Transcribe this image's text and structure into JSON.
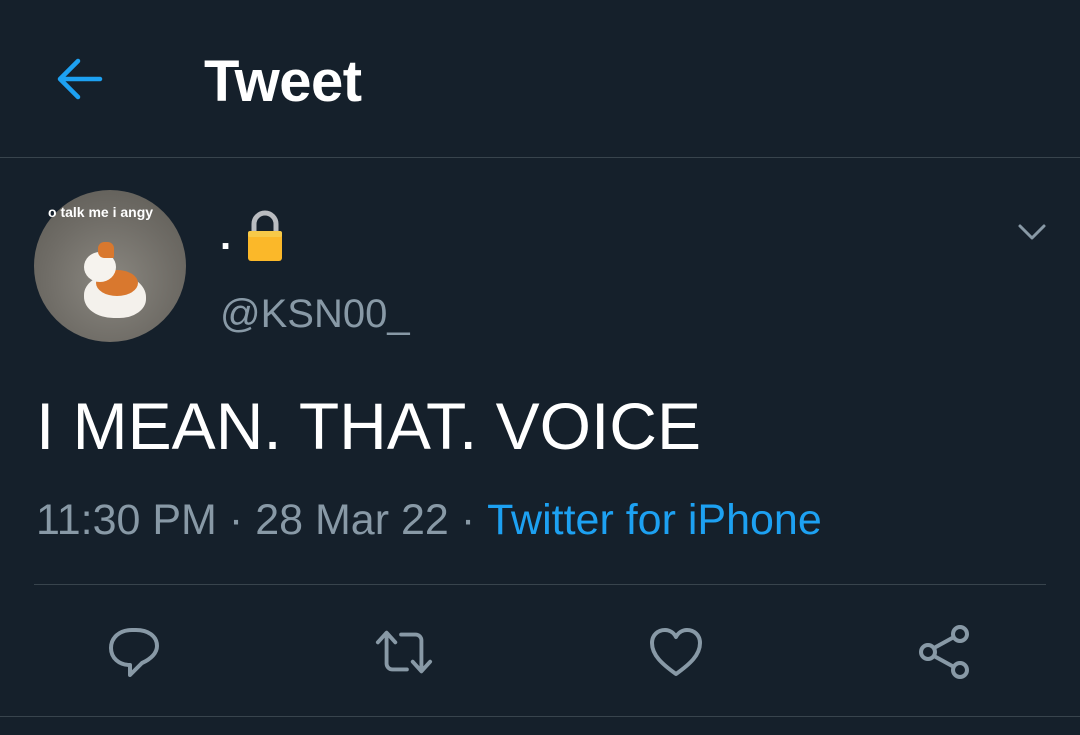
{
  "header": {
    "title": "Tweet",
    "back_icon": "arrow-left-icon",
    "accent_color": "#1da1f2"
  },
  "author": {
    "avatar_caption": "o talk me i angy",
    "display_name": ".",
    "display_name_emoji": "lock-icon",
    "handle": "@KSN00_"
  },
  "tweet": {
    "text": "I MEAN. THAT. VOICE",
    "time": "11:30 PM",
    "date": "28 Mar 22",
    "separator": "·",
    "source": "Twitter for iPhone"
  },
  "actions": [
    {
      "icon": "reply-icon"
    },
    {
      "icon": "retweet-icon"
    },
    {
      "icon": "like-icon"
    },
    {
      "icon": "share-icon"
    }
  ],
  "colors": {
    "background": "#15202b",
    "secondary_text": "#8899a6",
    "border": "#38444d"
  }
}
